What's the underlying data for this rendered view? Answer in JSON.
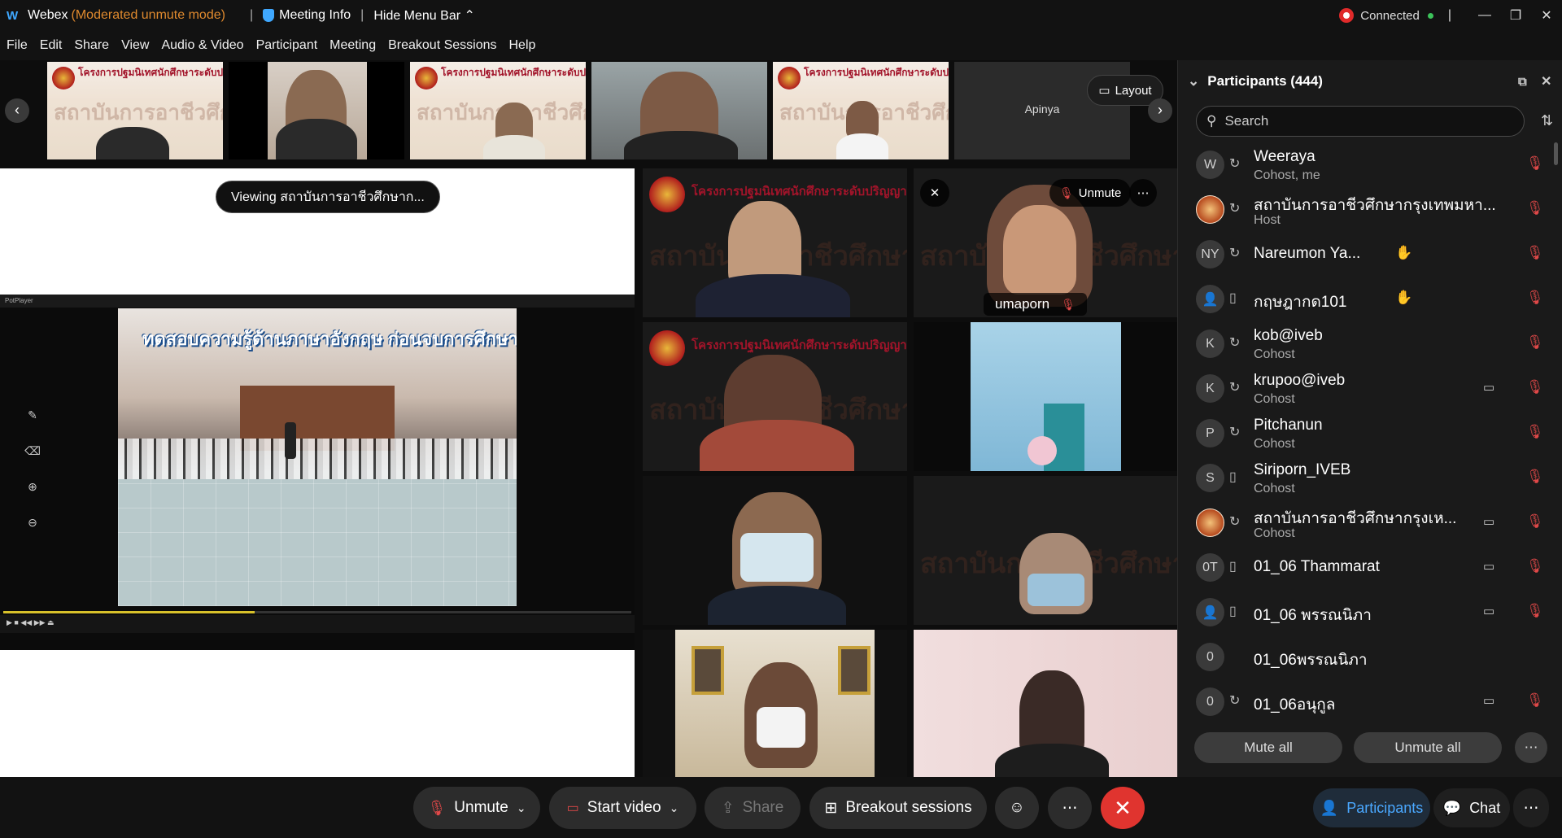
{
  "titlebar": {
    "app": "Webex",
    "mode": "(Moderated unmute mode)",
    "meeting_info": "Meeting Info",
    "hide_menu": "Hide Menu Bar",
    "connected": "Connected"
  },
  "menu": [
    "File",
    "Edit",
    "Share",
    "View",
    "Audio & Video",
    "Participant",
    "Meeting",
    "Breakout Sessions",
    "Help"
  ],
  "filmstrip": {
    "apinya": "Apinya",
    "layout": "Layout"
  },
  "share": {
    "viewing": "Viewing สถาบันการอาชีวศึกษาก...",
    "video_title": "ทดสอบความรู้ด้านภาษาอังกฤษ ก่อนจบการศึกษา",
    "player_name": "PotPlayer",
    "progress": 0.4
  },
  "banner": {
    "title": "โครงการปฐมนิเทศนักศึกษาระดับปริญญาตรี (Online)",
    "watermark": "สถาบันการอาชีวศึกษา"
  },
  "grid": {
    "active_name": "umaporn",
    "unmute": "Unmute"
  },
  "participants": {
    "title": "Participants (444)",
    "search_placeholder": "Search",
    "rows": [
      {
        "initials": "W",
        "name": "Weeraya",
        "role": "Cohost, me"
      },
      {
        "initials": "",
        "name": "สถาบันการอาชีวศึกษากรุงเทพมหา...",
        "role": "Host"
      },
      {
        "initials": "NY",
        "name": "Nareumon Ya...",
        "role": ""
      },
      {
        "initials": "",
        "name": "กฤษฎากด101",
        "role": ""
      },
      {
        "initials": "K",
        "name": "kob@iveb",
        "role": "Cohost"
      },
      {
        "initials": "K",
        "name": "krupoo@iveb",
        "role": "Cohost"
      },
      {
        "initials": "P",
        "name": "Pitchanun",
        "role": "Cohost"
      },
      {
        "initials": "S",
        "name": "Siriporn_IVEB",
        "role": "Cohost"
      },
      {
        "initials": "",
        "name": "สถาบันการอาชีวศึกษากรุงเห...",
        "role": "Cohost"
      },
      {
        "initials": "0T",
        "name": "01_06 Thammarat",
        "role": ""
      },
      {
        "initials": "",
        "name": "01_06 พรรณนิภา",
        "role": ""
      },
      {
        "initials": "0",
        "name": "01_06พรรณนิภา",
        "role": ""
      },
      {
        "initials": "0",
        "name": "01_06อนุกูล",
        "role": ""
      }
    ],
    "mute_all": "Mute all",
    "unmute_all": "Unmute all"
  },
  "bottombar": {
    "unmute": "Unmute",
    "start_video": "Start video",
    "share": "Share",
    "breakout": "Breakout sessions",
    "participants": "Participants",
    "chat": "Chat"
  }
}
